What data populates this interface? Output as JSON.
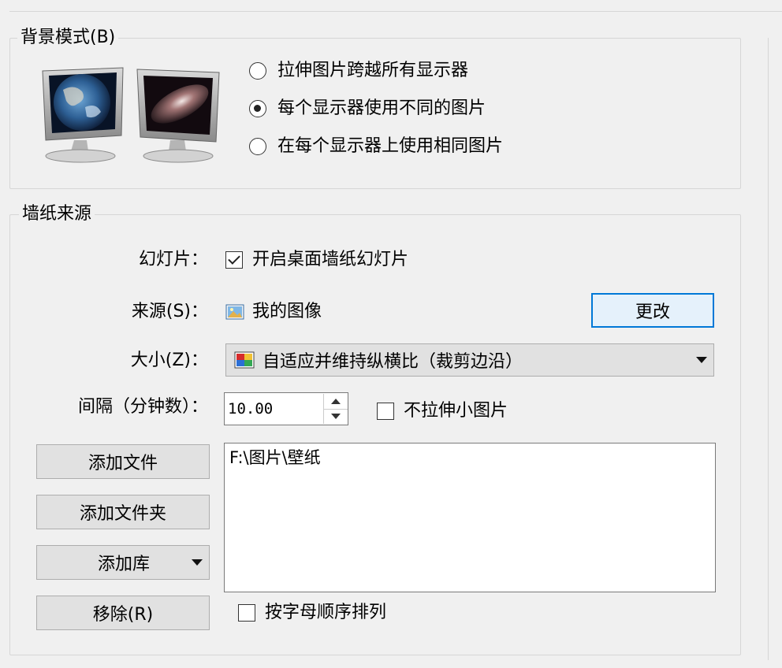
{
  "background_mode": {
    "title": "背景模式(B)",
    "options": [
      {
        "label": "拉伸图片跨越所有显示器",
        "selected": false
      },
      {
        "label": "每个显示器使用不同的图片",
        "selected": true
      },
      {
        "label": "在每个显示器上使用相同图片",
        "selected": false
      }
    ]
  },
  "wallpaper_source": {
    "title": "墙纸来源",
    "slideshow": {
      "label": "幻灯片：",
      "checkbox_label": "开启桌面墙纸幻灯片",
      "checked": true
    },
    "source": {
      "label": "来源(S)：",
      "value": "我的图像",
      "change_button": "更改"
    },
    "size": {
      "label": "大小(Z)：",
      "value": "自适应并维持纵横比（裁剪边沿）"
    },
    "interval": {
      "label": "间隔（分钟数）：",
      "value": "10.00"
    },
    "no_stretch": {
      "label": "不拉伸小图片",
      "checked": false
    },
    "buttons": {
      "add_file": "添加文件",
      "add_folder": "添加文件夹",
      "add_library": "添加库",
      "remove": "移除(R)"
    },
    "paths": [
      "F:\\图片\\壁纸"
    ],
    "sort_alpha": {
      "label": "按字母顺序排列",
      "checked": false
    }
  }
}
